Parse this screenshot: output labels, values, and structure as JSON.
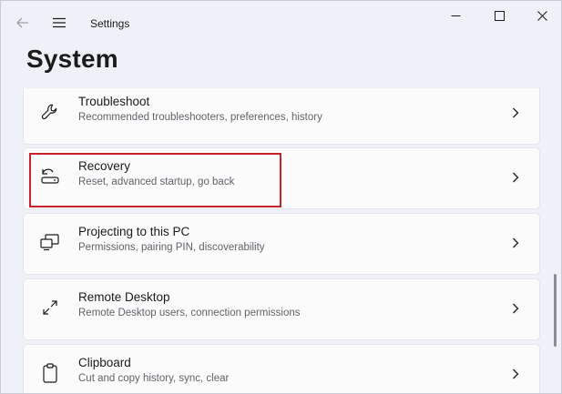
{
  "window": {
    "app_title": "Settings"
  },
  "page": {
    "title": "System"
  },
  "items": [
    {
      "title": "Troubleshoot",
      "subtitle": "Recommended troubleshooters, preferences, history",
      "icon": "wrench-icon"
    },
    {
      "title": "Recovery",
      "subtitle": "Reset, advanced startup, go back",
      "icon": "recovery-icon"
    },
    {
      "title": "Projecting to this PC",
      "subtitle": "Permissions, pairing PIN, discoverability",
      "icon": "projecting-icon"
    },
    {
      "title": "Remote Desktop",
      "subtitle": "Remote Desktop users, connection permissions",
      "icon": "remote-desktop-icon"
    },
    {
      "title": "Clipboard",
      "subtitle": "Cut and copy history, sync, clear",
      "icon": "clipboard-icon"
    }
  ],
  "colors": {
    "highlight": "#c7252d",
    "window_bg": "#eef1f7",
    "card_bg": "#fbfbfc"
  }
}
